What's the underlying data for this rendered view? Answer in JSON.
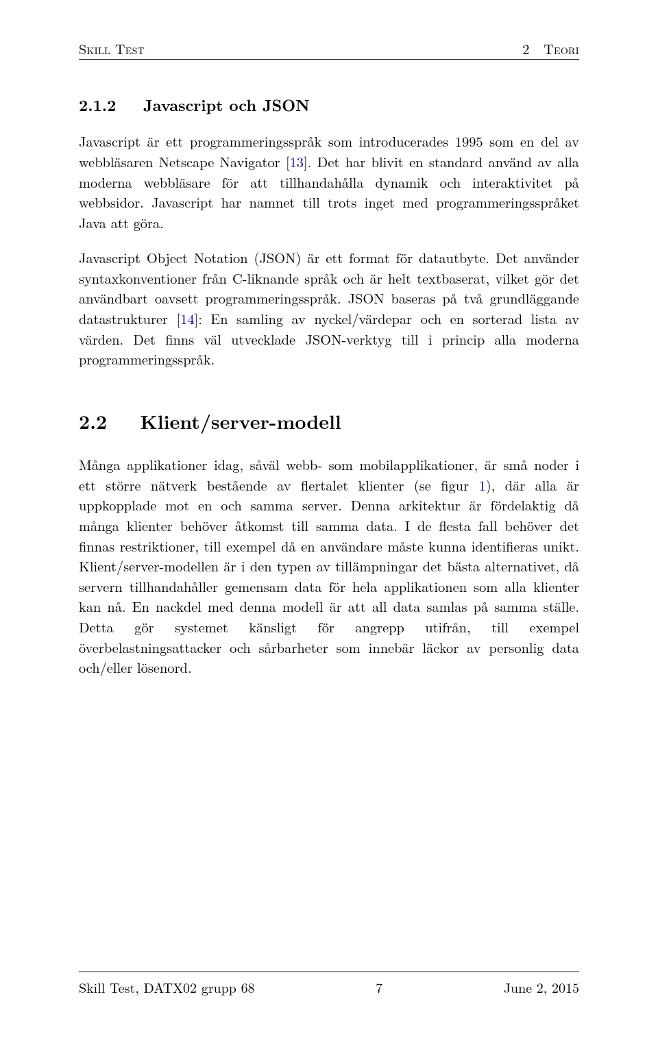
{
  "header": {
    "left": "Skill Test",
    "right_section_number": "2",
    "right_section_label": "Teori"
  },
  "subsection": {
    "number": "2.1.2",
    "title": "Javascript och JSON"
  },
  "para1": {
    "t1": "Javascript är ett programmeringsspråk som introducerades 1995 som en del av webbläsaren Netscape Navigator [",
    "c1": "13",
    "t2": "]. Det har blivit en standard använd av alla moderna webbläsare för att tillhandahålla dynamik och interaktivitet på webbsidor. Javascript har namnet till trots inget med programmeringsspråket Java att göra."
  },
  "para2": {
    "t1": "Javascript Object Notation (JSON) är ett format för datautbyte. Det använder syntaxkonventioner från C-liknande språk och är helt textbaserat, vilket gör det användbart oavsett programmeringsspråk. JSON baseras på två grundläggande datastrukturer [",
    "c1": "14",
    "t2": "]: En samling av nyckel/värdepar och en sorterad lista av värden. Det finns väl utvecklade JSON-verktyg till i princip alla moderna programmeringsspråk."
  },
  "section": {
    "number": "2.2",
    "title": "Klient/server-modell"
  },
  "para3": {
    "t1": "Många applikationer idag, såväl webb- som mobilapplikationer, är små noder i ett större nätverk bestående av flertalet klienter (se figur ",
    "figref": "1",
    "t2": "), där alla är uppkopplade mot en och samma server. Denna arkitektur är fördelaktig då många klienter behöver åtkomst till samma data. I de flesta fall behöver det finnas restriktioner, till exempel då en användare måste kunna identifieras unikt. Klient/server-modellen är i den typen av tillämpningar det bästa alternativet, då servern tillhandahåller gemensam data för hela applikationen som alla klienter kan nå. En nackdel med denna modell är att all data samlas på samma ställe. Detta gör systemet känsligt för angrepp utifrån, till exempel överbelastningsattacker och sårbarheter som innebär läckor av personlig data och/eller lösenord."
  },
  "footer": {
    "left": "Skill Test, DATX02 grupp 68",
    "center": "7",
    "right": "June 2, 2015"
  }
}
